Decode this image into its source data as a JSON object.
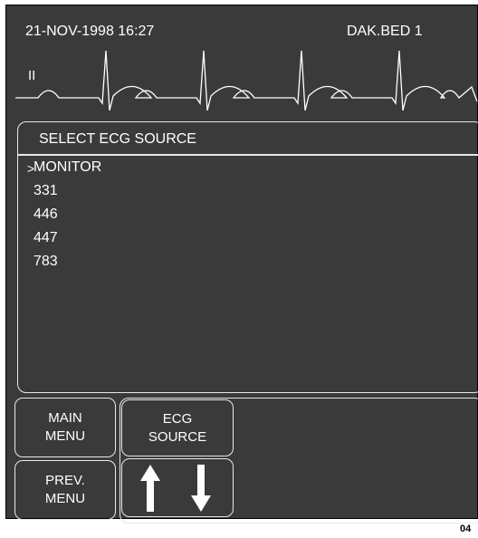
{
  "header": {
    "datetime": "21-NOV-1998   16:27",
    "bed": "DAK.BED 1"
  },
  "waveform": {
    "lead_label": "II"
  },
  "menu": {
    "title": "SELECT ECG SOURCE",
    "pointer": ">",
    "items": [
      "MONITOR",
      "331",
      "446",
      "447",
      "783"
    ],
    "selected_index": 0
  },
  "buttons": {
    "main_menu": [
      "MAIN",
      "MENU"
    ],
    "prev_menu": [
      "PREV.",
      "MENU"
    ],
    "ecg_source": [
      "ECG",
      "SOURCE"
    ]
  },
  "figure_number": "04"
}
